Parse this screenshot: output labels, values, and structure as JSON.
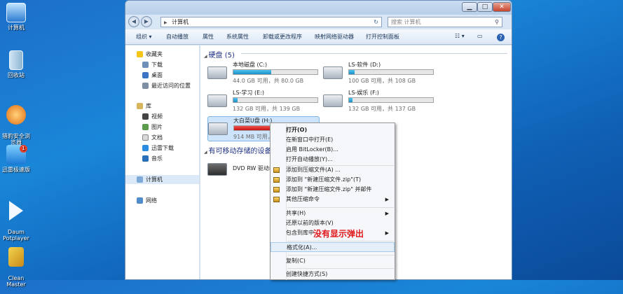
{
  "desktop": {
    "icons": [
      {
        "label": "计算机"
      },
      {
        "label": "回收站"
      },
      {
        "label": "猎豹安全浏\n览器"
      },
      {
        "label": "迅雷极速版",
        "badge": "1"
      },
      {
        "label": "Daum\nPotplayer"
      },
      {
        "label": "Clean\nMaster"
      }
    ]
  },
  "window": {
    "buttons": {
      "minimize": "▁",
      "maximize": "□",
      "close": "✕"
    },
    "nav": {
      "back": "◀",
      "forward": "▶"
    },
    "address": {
      "path": "计算机",
      "separator": "▶"
    },
    "search_placeholder": "搜索 计算机",
    "toolbar": [
      "组织 ▾",
      "自动播放",
      "属性",
      "系统属性",
      "卸载或更改程序",
      "映射网络驱动器",
      "打开控制面板"
    ],
    "navpane": {
      "favorites": {
        "label": "收藏夹",
        "items": [
          "下载",
          "桌面",
          "最近访问的位置"
        ]
      },
      "libraries": {
        "label": "库",
        "items": [
          "视频",
          "图片",
          "文档",
          "迅雷下载",
          "音乐"
        ]
      },
      "computer": "计算机",
      "network": "网络"
    },
    "groups": {
      "harddisks": "硬盘 (5)",
      "removable": "有可移动存储的设备"
    },
    "drives": [
      {
        "name": "本地磁盘 (C:)",
        "stat": "44.0 GB 可用，共 80.0 GB",
        "fill": 0.45,
        "color": "blue"
      },
      {
        "name": "LS-软件 (D:)",
        "stat": "100 GB 可用，共 108 GB",
        "fill": 0.07,
        "color": "blue"
      },
      {
        "name": "LS-学习 (E:)",
        "stat": "132 GB 可用，共 139 GB",
        "fill": 0.05,
        "color": "blue"
      },
      {
        "name": "LS-娱乐 (F:)",
        "stat": "132 GB 可用，共 137 GB",
        "fill": 0.04,
        "color": "blue"
      },
      {
        "name": "大白菜U盘 (H:)",
        "stat": "914 MB 可用，共",
        "fill": 0.9,
        "color": "red"
      }
    ],
    "dvd": {
      "name": "DVD RW 驱动器"
    }
  },
  "context_menu": {
    "items": [
      {
        "label": "打开(O)",
        "bold": true
      },
      {
        "label": "在新窗口中打开(E)"
      },
      {
        "label": "启用 BitLocker(B)..."
      },
      {
        "label": "打开自动播放(Y)..."
      },
      {
        "label": "添加到压缩文件(A) ...",
        "icon": true
      },
      {
        "label": "添加到 \"新建压缩文件.zip\"(T)",
        "icon": true
      },
      {
        "label": "添加到 \"新建压缩文件.zip\" 并邮件",
        "icon": true
      },
      {
        "label": "其他压缩命令",
        "icon": true,
        "submenu": true
      },
      {
        "label": "共享(H)",
        "submenu": true
      },
      {
        "label": "还原以前的版本(V)"
      },
      {
        "label": "包含到库中",
        "submenu": true
      },
      {
        "label": "格式化(A)...",
        "hover": true
      },
      {
        "label": "复制(C)"
      },
      {
        "label": "创建快捷方式(S)"
      }
    ],
    "annotation": "没有显示弹出"
  }
}
